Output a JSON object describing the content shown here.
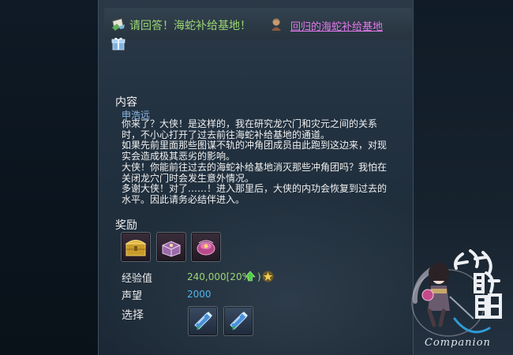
{
  "header": {
    "quest_icon": "quest-scroll-icon",
    "title": "请回答！海蛇补给基地！",
    "return_icon": "return-character-icon",
    "link_text": "回归的海蛇补给基地"
  },
  "gift_icon": "gift-box-icon",
  "content": {
    "section_title": "内容",
    "npc_name": "申浩远",
    "paragraphs": [
      "你来了？大侠！是这样的，我在研究龙穴门和灾元之间的关系时，不小心打开了过去前往海蛇补给基地的通道。",
      "如果先前里面那些图谋不轨的冲角团成员由此跑到这边来，对现实会造成极其恶劣的影响。",
      "大侠！你能前往过去的海蛇补给基地消灭那些冲角团吗？我怕在关闭龙穴门时会发生意外情况。",
      "多谢大侠！对了……！进入那里后，大侠的内功会恢复到过去的水平。因此请务必结伴进入。"
    ]
  },
  "rewards": {
    "section_title": "奖励",
    "items": [
      {
        "icon": "golden-chest-icon"
      },
      {
        "icon": "purple-chest-icon"
      },
      {
        "icon": "pink-pouch-icon"
      }
    ],
    "exp_label": "经验值",
    "exp_value": "240,000[20%",
    "exp_paren": ")",
    "exp_arrow_icon": "green-up-arrow-icon",
    "exp_star_icon": "gold-star-icon",
    "rep_label": "声望",
    "rep_value": "2000",
    "choice_label": "选择",
    "choice_items": [
      {
        "icon": "blue-scroll-icon"
      },
      {
        "icon": "blue-scroll-icon"
      }
    ]
  },
  "watermark": {
    "text": "Companion",
    "calligraphy": "攻略组"
  }
}
